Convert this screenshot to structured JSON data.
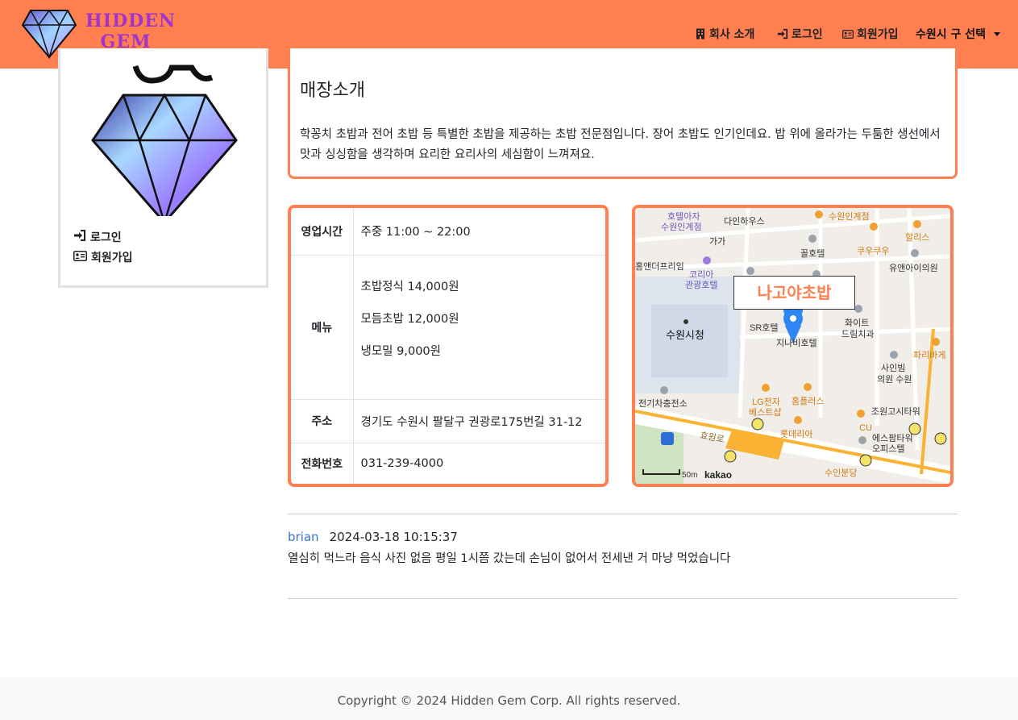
{
  "brand": {
    "line1": "HIDDEN",
    "line2": "GEM"
  },
  "nav": {
    "about": "회사 소개",
    "login": "로그인",
    "signup": "회원가입",
    "district": "수원시 구 선택"
  },
  "sidebar": {
    "login": "로그인",
    "signup": "회원가입"
  },
  "store": {
    "intro_title": "매장소개",
    "description": "학꽁치 초밥과 전어 초밥 등 특별한 초밥을 제공하는 초밥 전문점입니다. 장어 초밥도 인기인데요. 밥 위에 올라가는 두툼한 생선에서 맛과 싱싱함을 생각하며 요리한 요리사의 세심함이 느껴져요.",
    "hours_label": "영업시간",
    "hours": "주중 11:00 ~ 22:00",
    "menu_label": "메뉴",
    "menu": [
      "초밥정식 14,000원",
      "모듬초밥 12,000원",
      "냉모밀 9,000원"
    ],
    "address_label": "주소",
    "address": "경기도 수원시 팔달구 권광로175번길 31-12",
    "phone_label": "전화번호",
    "phone": "031-239-4000"
  },
  "map": {
    "marker_label": "나고야초밥",
    "places": [
      "호텔아자 수원인계점",
      "다인하우스",
      "수원인계점",
      "할리스",
      "가가",
      "꼴호텔",
      "쿠우쿠우",
      "유앤아이의원",
      "홈앤더프리임",
      "코리아 관광호텔",
      "화이트 드림치과",
      "수원시청",
      "SR호텔",
      "지나비호텔",
      "사인빔 의원 수원",
      "파리바게",
      "전기차충전소",
      "LG전자 베스트샵",
      "홈플러스",
      "롯데리아",
      "조원고시타워",
      "CU",
      "에스팜타워 오피스텔",
      "수인분당",
      "효원로"
    ],
    "scale": "50m",
    "provider": "kakao"
  },
  "comment": {
    "user": "brian",
    "time": "2024-03-18 10:15:37",
    "text": "열심히 먹느라 음식 사진 없음 평일 1시쯤 갔는데 손님이 없어서 전세낸 거 마냥 먹었습니다"
  },
  "footer": {
    "copyright": "Copyright © 2024 Hidden Gem Corp. All rights reserved."
  },
  "colors": {
    "accent": "#ff7f50",
    "brand_text": "#a035c8",
    "link": "#3b6fd1"
  }
}
